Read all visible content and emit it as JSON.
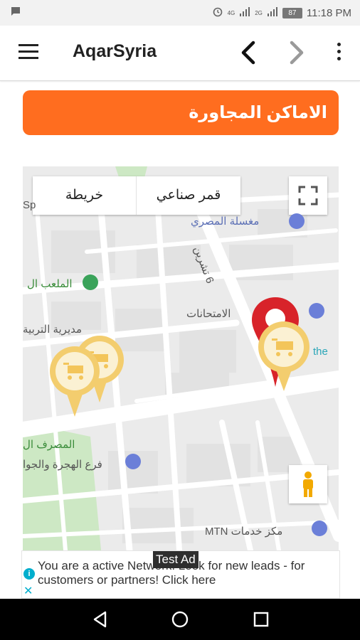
{
  "status_bar": {
    "time": "11:18 PM",
    "battery": "87",
    "network_1": "4G",
    "network_2": "2G",
    "icons": [
      "message-icon",
      "alarm-icon",
      "signal-icon",
      "signal-icon",
      "battery-icon"
    ]
  },
  "app_bar": {
    "title": "AqarSyria",
    "icons": [
      "menu-icon",
      "back-arrow-icon",
      "forward-arrow-icon",
      "more-vert-icon"
    ]
  },
  "section_header": {
    "title": "الاماكن المجاورة",
    "color": "#ff6d1f"
  },
  "map": {
    "type_options": {
      "map": "خريطة",
      "satellite": "قمر صناعي"
    },
    "labels": {
      "laundry": "مغسلة المصري",
      "street": "6 تشرين",
      "stadium": "الملعب ال",
      "exams": "الامتحانات",
      "education": "مديرية التربية",
      "bank": "المصرف ال",
      "migration": "فرع الهجرة والجوا",
      "mtn": "مكز خدمات MTN",
      "sp": "Sp",
      "the": "the"
    },
    "marker_color": "#f3cd6e",
    "selected_marker_color": "#d8232a"
  },
  "ad": {
    "badge": "Test Ad",
    "text": "You are a active Network. Look for new leads - for customers or partners! Click here"
  },
  "nav_bar": {
    "icons": [
      "back-triangle-icon",
      "home-circle-icon",
      "recents-square-icon"
    ]
  }
}
